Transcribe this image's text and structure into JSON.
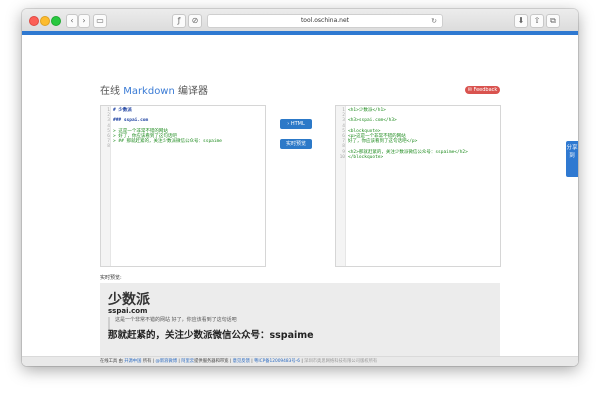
{
  "browser": {
    "url": "tool.oschina.net",
    "buttons": {
      "back": "‹",
      "forward": "›",
      "reader": "▭",
      "reload": "↻",
      "download": "⬇",
      "share": "⇧",
      "tabs": "⧉",
      "extension": "ƒ",
      "block": "⊘"
    }
  },
  "page": {
    "title_prefix": "在线 ",
    "title_highlight": "Markdown",
    "title_suffix": " 编译器",
    "feedback": "✉ Feedback",
    "share_tab": "分享到",
    "buttons": {
      "to_html": "› HTML",
      "live_preview": "实时预览"
    },
    "preview_label": "实时预览:"
  },
  "editor_left": [
    {
      "n": "1",
      "text": "# 少数派",
      "cls": "c-h"
    },
    {
      "n": "2",
      "text": "",
      "cls": "c-x"
    },
    {
      "n": "3",
      "text": "### sspai.com",
      "cls": "c-h"
    },
    {
      "n": "4",
      "text": "",
      "cls": "c-x"
    },
    {
      "n": "5",
      "text": "> 这是一个非常不错的网站",
      "cls": "c-q"
    },
    {
      "n": "6",
      "text": "> 好了，你应该看到了这句话吧",
      "cls": "c-q"
    },
    {
      "n": "7",
      "text": "> ## 那就赶紧的，关注少数派微信公众号：sspaime",
      "cls": "c-q"
    },
    {
      "n": "8",
      "text": "",
      "cls": "c-x"
    }
  ],
  "editor_right": [
    {
      "n": "1",
      "text": "<h1>少数派</h1>",
      "cls": "c-t"
    },
    {
      "n": "2",
      "text": "",
      "cls": "c-x"
    },
    {
      "n": "3",
      "text": "<h3>sspai.com</h3>",
      "cls": "c-t"
    },
    {
      "n": "4",
      "text": "",
      "cls": "c-x"
    },
    {
      "n": "5",
      "text": "<blockquote>",
      "cls": "c-t"
    },
    {
      "n": "6",
      "text": "  <p>这是一个非常不错的网站",
      "cls": "c-t"
    },
    {
      "n": "7",
      "text": "  好了，你应该看到了这句话吧</p>",
      "cls": "c-t"
    },
    {
      "n": "8",
      "text": "",
      "cls": "c-x"
    },
    {
      "n": "9",
      "text": "  <h2>那就赶紧的，关注少数派微信公众号：sspaime</h2>",
      "cls": "c-t"
    },
    {
      "n": "10",
      "text": "</blockquote>",
      "cls": "c-t"
    }
  ],
  "preview": {
    "h1": "少数派",
    "h3": "sspai.com",
    "quote": "这是一个非常不错的网站 好了，你应该看到了这句话吧",
    "h2": "那就赶紧的，关注少数派微信公众号：sspaime"
  },
  "footer": {
    "p1": "在线工具 由 ",
    "link1": "开源中国",
    "p2": " 所有 | ",
    "link2": "@新浪微博",
    "p3": " | ",
    "link3": "阿里云",
    "p4": "提供服务器和带宽 | ",
    "link4": "意见反馈",
    "p5": " | ",
    "link5": "粤ICP备12009483号-6",
    "p6": " | ",
    "gray": "深圳市奥思网络科技有限公司版权所有"
  }
}
